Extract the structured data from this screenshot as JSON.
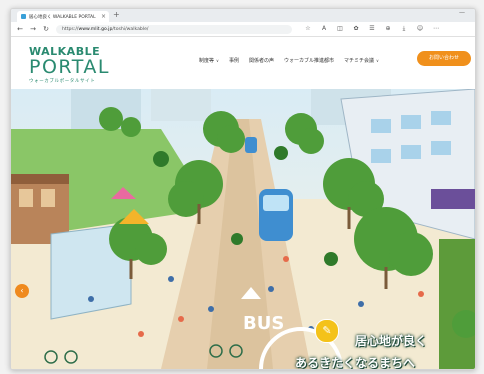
{
  "browser": {
    "tab_title": "居心地良く WALKABLE PORTAL",
    "url_prefix": "https://",
    "url_domain": "www.mlit.go.jp",
    "url_path": "/toshi/walkable/",
    "new_tab_icon": "plus-icon",
    "window_controls": "—",
    "icons": [
      "back-icon",
      "forward-icon",
      "reload-icon",
      "star-icon",
      "extensions-icon",
      "profile-icon",
      "menu-icon"
    ]
  },
  "site": {
    "logo_line1": "WALKABLE",
    "logo_line2": "PORTAL",
    "logo_sub": "ウォーカブルポータルサイト",
    "nav": [
      {
        "label": "制度等",
        "dropdown": true
      },
      {
        "label": "事例",
        "dropdown": false
      },
      {
        "label": "関係者の声",
        "dropdown": false
      },
      {
        "label": "ウォーカブル推進都市",
        "dropdown": false
      },
      {
        "label": "マチミチ会議",
        "dropdown": true
      }
    ],
    "contact_label": "お問い合わせ",
    "accent_color": "#f0901c",
    "brand_color": "#2a8a70"
  },
  "hero": {
    "bus_marking": "BUS",
    "caption_line1": "居心地が良く",
    "caption_line2": "あるきたくなるまちへ",
    "pencil_icon": "✎",
    "prev_arrow": "‹"
  }
}
